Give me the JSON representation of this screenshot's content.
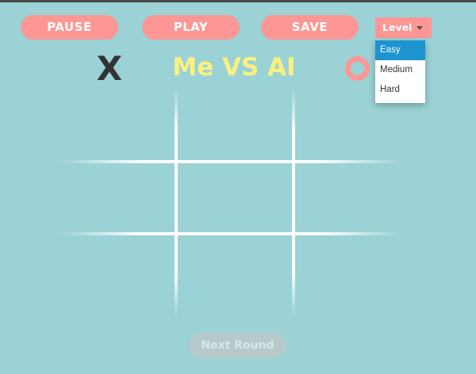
{
  "toolbar": {
    "pause_label": "PAUSE",
    "play_label": "PLAY",
    "save_label": "SAVE"
  },
  "level": {
    "label": "Level",
    "options": [
      "Easy",
      "Medium",
      "Hard"
    ],
    "selected": "Easy",
    "open": true
  },
  "header": {
    "title": "Me VS AI",
    "player_symbol": "X",
    "ai_symbol": "O"
  },
  "board": {
    "rows": 3,
    "cols": 3,
    "cells": [
      "",
      "",
      "",
      "",
      "",
      "",
      "",
      "",
      ""
    ]
  },
  "footer": {
    "next_round_label": "Next Round",
    "next_round_enabled": false
  },
  "colors": {
    "background": "#9ad2d6",
    "accent": "#fc9795",
    "title": "#fbf07f",
    "x_mark": "#333333",
    "grid": "#ffffff",
    "menu_selected": "#1d93d0",
    "disabled_button": "#b6c9cb"
  },
  "icons": {
    "level_caret": "caret-down-icon",
    "player_mark": "x-mark-icon",
    "ai_mark": "o-ring-icon"
  }
}
